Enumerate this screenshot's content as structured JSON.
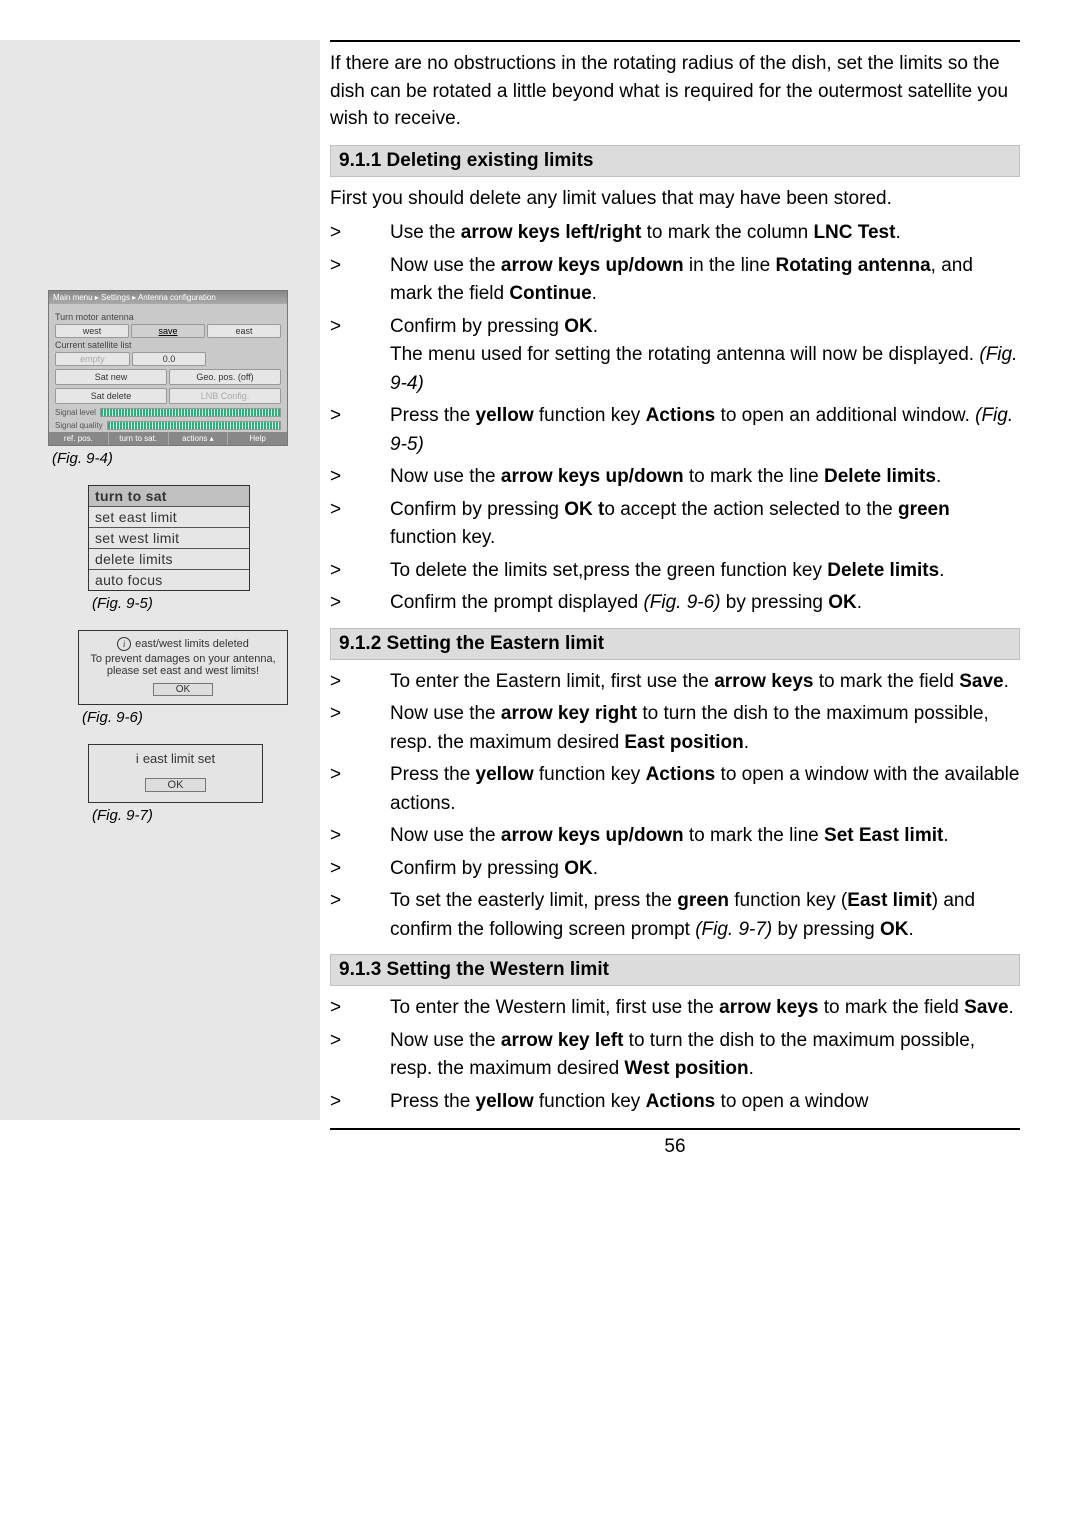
{
  "page_number": "56",
  "intro": "If there are no obstructions in the rotating radius of the dish, set the limits so the dish can be rotated a little beyond what is required for the outermost satellite you wish to receive.",
  "s911": {
    "heading": "9.1.1 Deleting existing limits",
    "lead": "First you should delete any limit values that may have been stored.",
    "steps": {
      "a1": "Use the ",
      "a2": "arrow keys left/right",
      "a3": " to mark the column ",
      "a4": "LNC Test",
      "a5": ".",
      "b1": "Now use the ",
      "b2": "arrow keys up/down",
      "b3": " in the line ",
      "b4": "Rotating antenna",
      "b5": ", and mark the field ",
      "b6": "Continue",
      "b7": ".",
      "c1": "Confirm by pressing ",
      "c2": "OK",
      "c3": ".",
      "c_sub": "The menu used for setting the rotating antenna will now be displayed. ",
      "c_subfig": "(Fig. 9-4)",
      "d1": "Press the ",
      "d2": "yellow",
      "d3": " function key ",
      "d4": "Actions",
      "d5": " to open an additional window. ",
      "d6": "(Fig. 9-5)",
      "e1": "Now use the ",
      "e2": "arrow keys up/down",
      "e3": " to mark the line ",
      "e4": "Delete limits",
      "e5": ".",
      "f1": "Confirm by pressing ",
      "f2": "OK t",
      "f3": "o accept the action selected to the ",
      "f4": "green",
      "f5": " function key.",
      "g1": "To delete the limits set,press the green function key ",
      "g2": "Delete limits",
      "g3": ".",
      "h1": "Confirm the prompt displayed ",
      "h2": "(Fig. 9-6)",
      "h3": " by pressing ",
      "h4": "OK",
      "h5": "."
    }
  },
  "s912": {
    "heading": "9.1.2 Setting the Eastern limit",
    "steps": {
      "a1": "To enter the Eastern limit, first use the ",
      "a2": "arrow keys",
      "a3": " to mark the field ",
      "a4": "Save",
      "a5": ".",
      "b1": "Now use the ",
      "b2": "arrow key right",
      "b3": " to turn the dish to the maximum possible, resp. the maximum desired ",
      "b4": "East position",
      "b5": ".",
      "c1": "Press the ",
      "c2": "yellow",
      "c3": " function key ",
      "c4": "Actions",
      "c5": " to open a window with the available actions.",
      "d1": "Now use the ",
      "d2": "arrow keys up/down",
      "d3": " to mark the line ",
      "d4": "Set East limit",
      "d5": ".",
      "e1": "Confirm by pressing ",
      "e2": "OK",
      "e3": ".",
      "f1": "To set the easterly limit, press the ",
      "f2": "green",
      "f3": " function key (",
      "f4": "East limit",
      "f5": ") and confirm the following screen prompt ",
      "f6": "(Fig. 9-7)",
      "f7": " by pressing ",
      "f8": "OK",
      "f9": "."
    }
  },
  "s913": {
    "heading": "9.1.3 Setting the Western limit",
    "steps": {
      "a1": "To enter the Western limit, first use the ",
      "a2": "arrow keys",
      "a3": " to mark the field ",
      "a4": "Save",
      "a5": ".",
      "b1": "Now use the ",
      "b2": "arrow key left",
      "b3": " to turn the dish to the maximum possible, resp. the maximum desired ",
      "b4": "West position",
      "b5": ".",
      "c1": "Press the ",
      "c2": "yellow",
      "c3": " function key ",
      "c4": "Actions",
      "c5": " to open a window"
    }
  },
  "fig94": {
    "caption": "(Fig. 9-4)",
    "breadcrumb": "Main menu ▸ Settings ▸ Antenna configuration",
    "turn_label": "Turn motor antenna",
    "west": "west",
    "save": "save",
    "east": "east",
    "curr_label": "Current satellite list",
    "empty": "empty",
    "deg": "0.0",
    "satnew": "Sat new",
    "geo": "Geo. pos. (off)",
    "satdel": "Sat delete",
    "lnb": "LNB Config.",
    "siglvl": "Signal level",
    "sigq": "Signal quality",
    "b1": "ref. pos.",
    "b2": "turn to sat.",
    "b3": "actions ▴",
    "b4": "Help"
  },
  "fig95": {
    "caption": "(Fig. 9-5)",
    "r1": "turn to sat",
    "r2": "set east limit",
    "r3": "set west limit",
    "r4": "delete limits",
    "r5": "auto focus"
  },
  "fig96": {
    "caption": "(Fig. 9-6)",
    "title": "east/west limits deleted",
    "body": "To prevent damages on your antenna, please set east and west limits!",
    "ok": "OK"
  },
  "fig97": {
    "caption": "(Fig. 9-7)",
    "title": "east limit set",
    "ok": "OK"
  },
  "chevron": ">"
}
